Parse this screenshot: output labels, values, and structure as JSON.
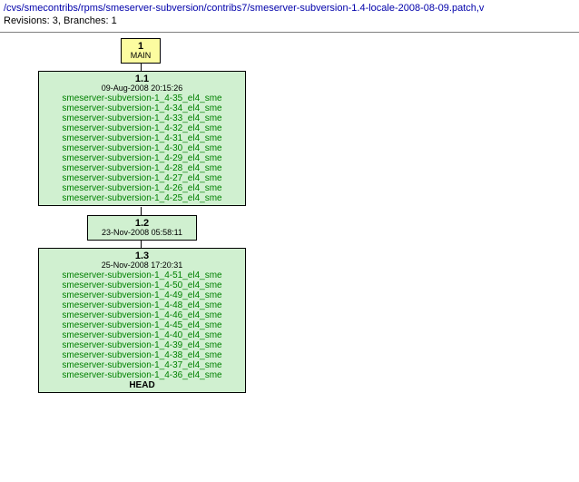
{
  "header": {
    "path": "/cvs/smecontribs/rpms/smeserver-subversion/contribs7/smeserver-subversion-1.4-locale-2008-08-09.patch,v",
    "revline": "Revisions: 3, Branches: 1"
  },
  "branch": {
    "number": "1",
    "name": "MAIN"
  },
  "rev11": {
    "version": "1.1",
    "date": "09-Aug-2008 20:15:26",
    "tags": [
      "smeserver-subversion-1_4-35_el4_sme",
      "smeserver-subversion-1_4-34_el4_sme",
      "smeserver-subversion-1_4-33_el4_sme",
      "smeserver-subversion-1_4-32_el4_sme",
      "smeserver-subversion-1_4-31_el4_sme",
      "smeserver-subversion-1_4-30_el4_sme",
      "smeserver-subversion-1_4-29_el4_sme",
      "smeserver-subversion-1_4-28_el4_sme",
      "smeserver-subversion-1_4-27_el4_sme",
      "smeserver-subversion-1_4-26_el4_sme",
      "smeserver-subversion-1_4-25_el4_sme"
    ]
  },
  "rev12": {
    "version": "1.2",
    "date": "23-Nov-2008 05:58:11"
  },
  "rev13": {
    "version": "1.3",
    "date": "25-Nov-2008 17:20:31",
    "tags": [
      "smeserver-subversion-1_4-51_el4_sme",
      "smeserver-subversion-1_4-50_el4_sme",
      "smeserver-subversion-1_4-49_el4_sme",
      "smeserver-subversion-1_4-48_el4_sme",
      "smeserver-subversion-1_4-46_el4_sme",
      "smeserver-subversion-1_4-45_el4_sme",
      "smeserver-subversion-1_4-40_el4_sme",
      "smeserver-subversion-1_4-39_el4_sme",
      "smeserver-subversion-1_4-38_el4_sme",
      "smeserver-subversion-1_4-37_el4_sme",
      "smeserver-subversion-1_4-36_el4_sme"
    ],
    "head": "HEAD"
  }
}
